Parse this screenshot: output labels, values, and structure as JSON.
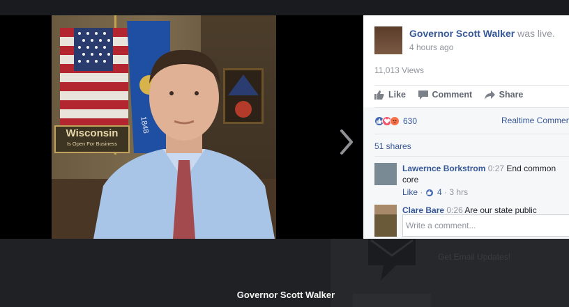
{
  "post": {
    "author": "Governor Scott Walker",
    "status": "was live.",
    "time": "4 hours ago",
    "views": "11,013 Views"
  },
  "actions": {
    "like": "Like",
    "comment": "Comment",
    "share": "Share"
  },
  "reactions": {
    "count": "630",
    "types": [
      "like",
      "love",
      "angry"
    ],
    "colors": {
      "like": "#4267b2",
      "love": "#f25268",
      "angry": "#f7714b"
    },
    "realtime_label": "Realtime Comments"
  },
  "shares": "51 shares",
  "comments": [
    {
      "name": "Lawernce Borkstrom",
      "time": "0:27",
      "text": "End common core",
      "like_label": "Like",
      "like_count": "4",
      "age": "3 hrs"
    },
    {
      "name": "Clare Bare",
      "time": "0:26",
      "text": "Are our state public"
    }
  ],
  "composer": {
    "placeholder": "Write a comment..."
  },
  "video": {
    "sign_title": "Wisconsin",
    "sign_subtitle": "Is Open For Business",
    "flag_text": "1848"
  },
  "background": {
    "email_updates": "Get Email Updates!",
    "page_title": "Governor Scott Walker"
  },
  "icons": {
    "next": "chevron-right-icon",
    "like": "thumbs-up-icon",
    "comment": "speech-bubble-icon",
    "share": "share-arrow-icon",
    "email": "envelope-icon"
  },
  "colors": {
    "link": "#365899",
    "muted": "#90949c"
  }
}
